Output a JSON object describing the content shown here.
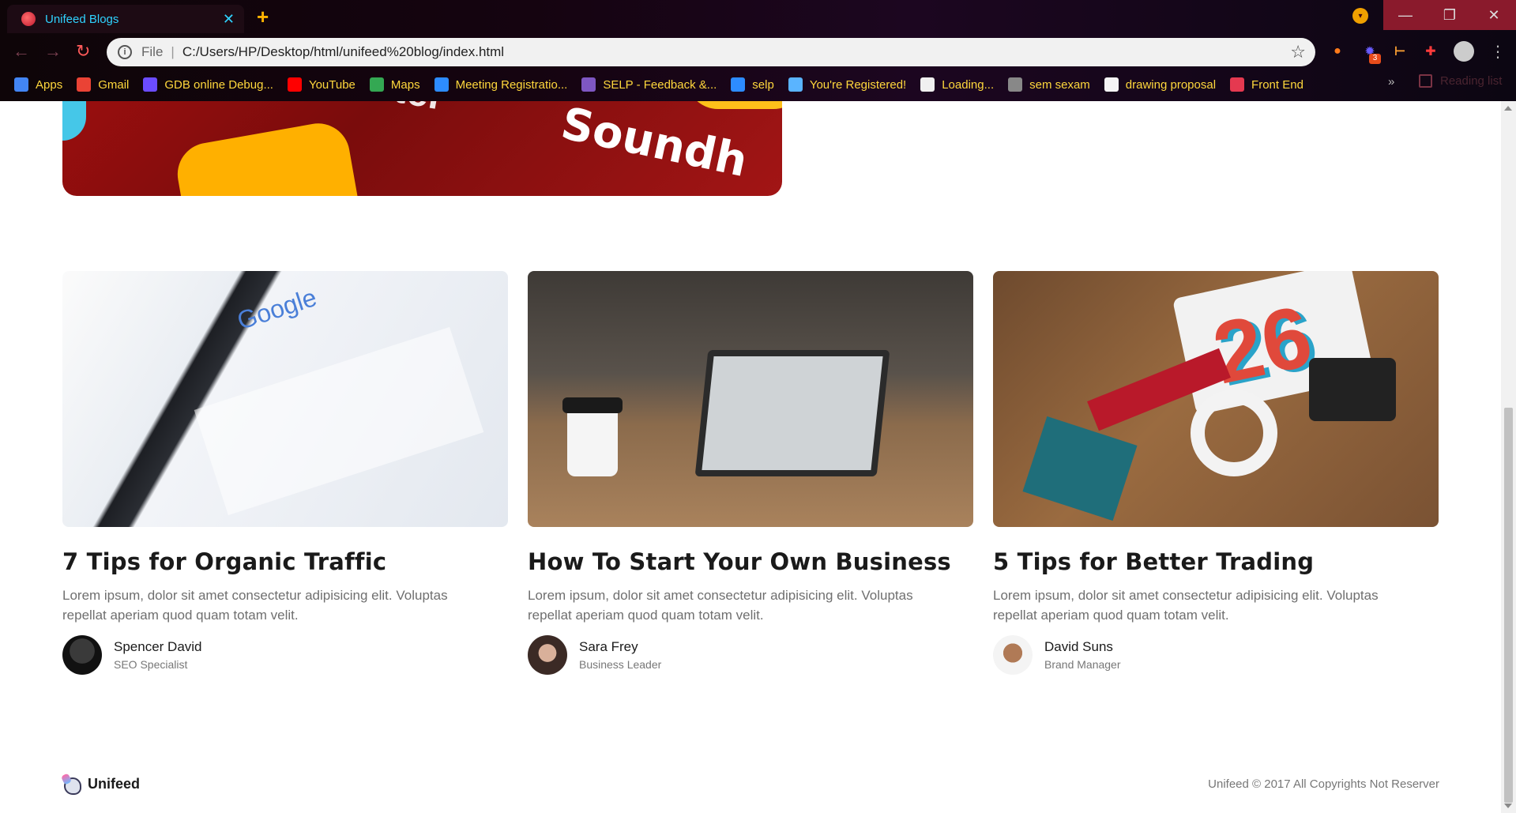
{
  "browser": {
    "tab_title": "Unifeed Blogs",
    "tab_close": "✕",
    "new_tab": "+",
    "url_scheme": "File",
    "url": "C:/Users/HP/Desktop/html/unifeed%20blog/index.html",
    "extension_badge": "3",
    "bookmarks": [
      {
        "label": "Apps",
        "icon": "apps-grid-icon",
        "color": "#4285f4"
      },
      {
        "label": "Gmail",
        "icon": "gmail-icon",
        "color": "#ea4335"
      },
      {
        "label": "GDB online Debug...",
        "icon": "bolt-icon",
        "color": "#6b4cff"
      },
      {
        "label": "YouTube",
        "icon": "youtube-icon",
        "color": "#ff0000"
      },
      {
        "label": "Maps",
        "icon": "maps-icon",
        "color": "#34a853"
      },
      {
        "label": "Meeting Registratio...",
        "icon": "zoom-icon",
        "color": "#2d8cff"
      },
      {
        "label": "SELP - Feedback &...",
        "icon": "form-icon",
        "color": "#7e57c2"
      },
      {
        "label": "selp",
        "icon": "zoom-icon",
        "color": "#2d8cff"
      },
      {
        "label": "You're Registered!",
        "icon": "gear-icon",
        "color": "#5ab4ff"
      },
      {
        "label": "Loading...",
        "icon": "page-icon",
        "color": "#f0f0f0"
      },
      {
        "label": "sem sexam",
        "icon": "camera-icon",
        "color": "#888888"
      },
      {
        "label": "drawing proposal",
        "icon": "doc-icon",
        "color": "#f5f5f5"
      },
      {
        "label": "Front End",
        "icon": "globe-icon",
        "color": "#e53950"
      }
    ],
    "more_bookmarks": "»",
    "reading_list": "Reading list"
  },
  "posts": [
    {
      "title": "7 Tips for Organic Traffic",
      "excerpt": "Lorem ipsum, dolor sit amet consectetur adipisicing elit. Voluptas repellat aperiam quod quam totam velit.",
      "author": "Spencer David",
      "role": "SEO Specialist"
    },
    {
      "title": "How To Start Your Own Business",
      "excerpt": "Lorem ipsum, dolor sit amet consectetur adipisicing elit. Voluptas repellat aperiam quod quam totam velit.",
      "author": "Sara Frey",
      "role": "Business Leader"
    },
    {
      "title": "5 Tips for Better Trading",
      "excerpt": "Lorem ipsum, dolor sit amet consectetur adipisicing elit. Voluptas repellat aperiam quod quam totam velit.",
      "author": "David Suns",
      "role": "Brand Manager"
    }
  ],
  "footer": {
    "brand": "Unifeed",
    "copyright": "Unifeed © 2017 All Copyrights Not Reserver"
  }
}
